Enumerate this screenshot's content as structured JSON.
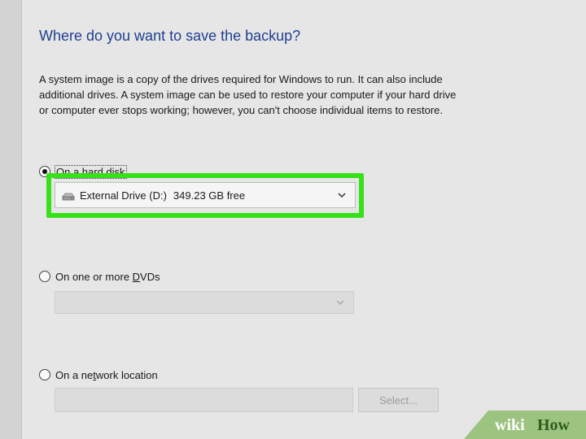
{
  "dialog": {
    "title": "Where do you want to save the backup?",
    "description_lines": [
      "A system image is a copy of the drives required for Windows to run. It can also include",
      "additional drives. A system image can be used to restore your computer if your hard drive",
      "or computer ever stops working; however, you can't choose individual items to restore."
    ]
  },
  "options": {
    "hard_disk": {
      "label": "On a hard disk",
      "selected": true,
      "drive_name": "External Drive (D:)",
      "drive_free": "349.23 GB free"
    },
    "dvd": {
      "label_pre": "On one or more ",
      "label_accel": "D",
      "label_post": "VDs",
      "selected": false
    },
    "network": {
      "label_pre": "On a ne",
      "label_accel": "t",
      "label_post": "work location",
      "selected": false,
      "input_value": "",
      "select_button": "Select..."
    }
  },
  "watermark": {
    "part1": "wiki",
    "part2": "How"
  },
  "colors": {
    "highlight": "#37e11a",
    "title": "#1f3f8f",
    "background": "#e6e6e6"
  },
  "icons": [
    "drive-icon",
    "chevron-down-icon"
  ]
}
